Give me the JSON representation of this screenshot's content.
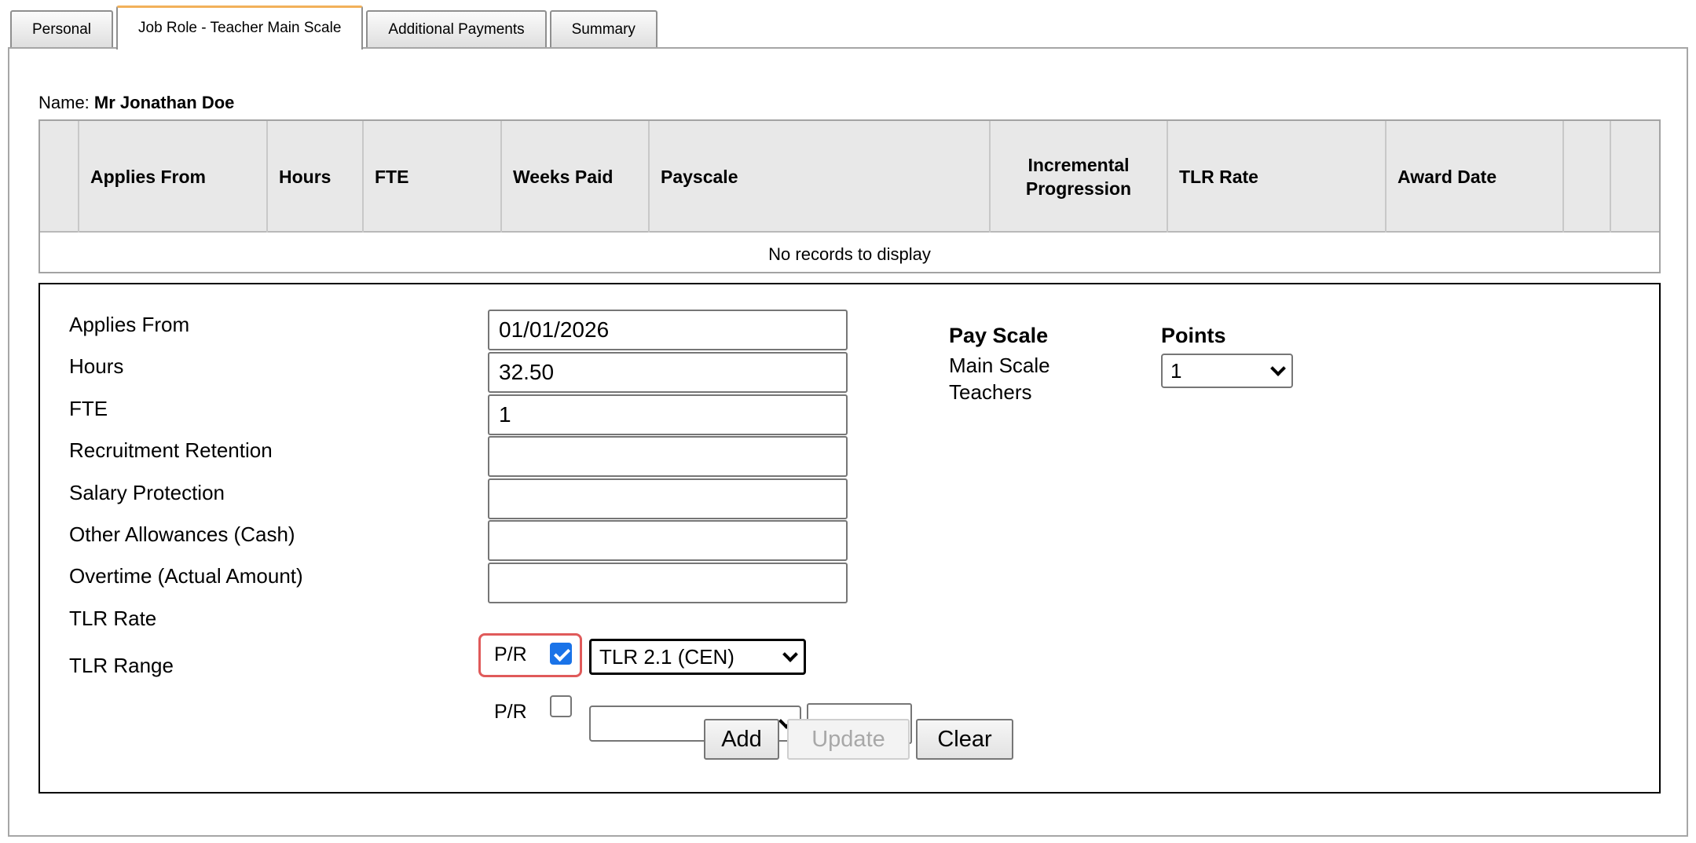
{
  "tabs": [
    {
      "label": "Personal",
      "active": false
    },
    {
      "label": "Job Role - Teacher Main Scale",
      "active": true
    },
    {
      "label": "Additional Payments",
      "active": false
    },
    {
      "label": "Summary",
      "active": false
    }
  ],
  "name": {
    "prefix": "Name:",
    "value": "Mr Jonathan Doe"
  },
  "grid": {
    "columns": [
      "",
      "Applies From",
      "Hours",
      "FTE",
      "Weeks Paid",
      "Payscale",
      "Incremental Progression",
      "TLR Rate",
      "Award Date",
      "",
      ""
    ],
    "empty_message": "No records to display"
  },
  "form": {
    "labels": {
      "applies_from": "Applies From",
      "hours": "Hours",
      "fte": "FTE",
      "recruitment_retention": "Recruitment Retention",
      "salary_protection": "Salary Protection",
      "other_allowances": "Other Allowances (Cash)",
      "overtime": "Overtime (Actual Amount)",
      "tlr_rate": "TLR Rate",
      "tlr_range": "TLR Range"
    },
    "values": {
      "applies_from": "01/01/2026",
      "hours": "32.50",
      "fte": "1",
      "recruitment_retention": "",
      "salary_protection": "",
      "other_allowances": "",
      "overtime": ""
    },
    "tlr_rate": {
      "pr_label": "P/R",
      "pr_checked": true,
      "selected": "TLR 2.1 (CEN)"
    },
    "tlr_range": {
      "pr_label": "P/R",
      "pr_checked": false,
      "selected": "",
      "amount": ""
    },
    "pay_scale": {
      "heading": "Pay Scale",
      "line1": "Main Scale",
      "line2": "Teachers"
    },
    "points": {
      "heading": "Points",
      "selected": "1"
    },
    "buttons": {
      "add": "Add",
      "update": "Update",
      "clear": "Clear"
    }
  },
  "colors": {
    "active_tab_accent": "#f2b15a",
    "highlight": "#e05a5a",
    "checkbox_checked": "#1a73e8"
  }
}
